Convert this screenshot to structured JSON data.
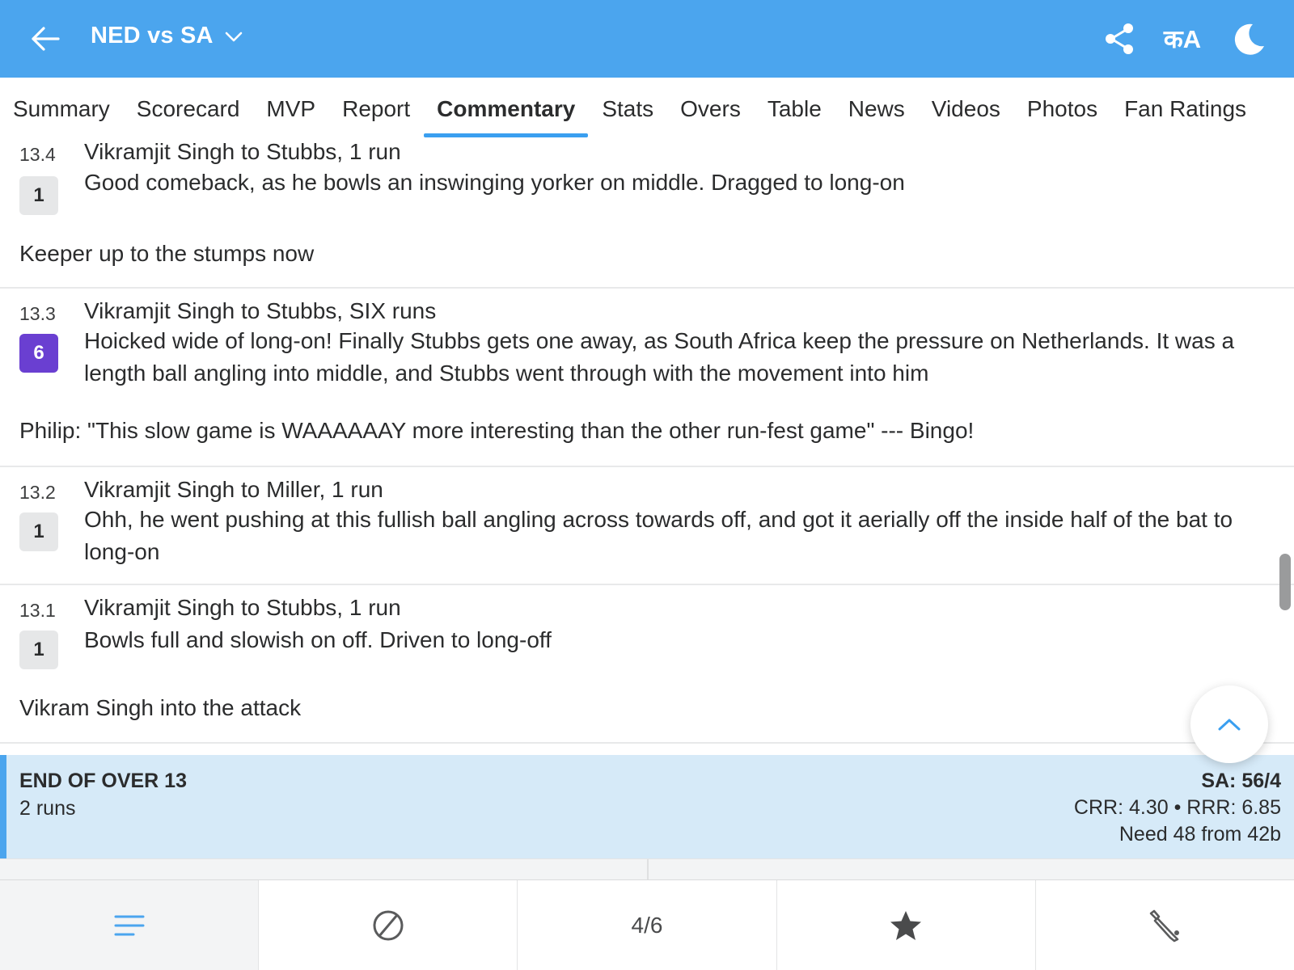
{
  "header": {
    "title": "NED vs SA",
    "language_label": "क​A",
    "icons": [
      "back-arrow-icon",
      "chevron-down-icon",
      "share-icon",
      "language-icon",
      "moon-icon"
    ]
  },
  "tabs": [
    {
      "label": "Summary"
    },
    {
      "label": "Scorecard"
    },
    {
      "label": "MVP"
    },
    {
      "label": "Report"
    },
    {
      "label": "Commentary",
      "active": true
    },
    {
      "label": "Stats"
    },
    {
      "label": "Overs"
    },
    {
      "label": "Table"
    },
    {
      "label": "News"
    },
    {
      "label": "Videos"
    },
    {
      "label": "Photos"
    },
    {
      "label": "Fan Ratings"
    }
  ],
  "commentary": [
    {
      "over": "13.4",
      "runs": "1",
      "title": "Vikramjit Singh to Stubbs, 1 run",
      "text": "Good comeback, as he bowls an inswinging yorker on middle. Dragged to long-on",
      "note": "Keeper up to the stumps now"
    },
    {
      "over": "13.3",
      "runs": "6",
      "title": "Vikramjit Singh to Stubbs, SIX runs",
      "text": "Hoicked wide of long-on! Finally Stubbs gets one away, as South Africa keep the pressure on Netherlands. It was a length ball angling into middle, and Stubbs went through with the movement into him",
      "note": "Philip: \"This slow game is WAAAAAAY more interesting than the other run-fest game\" --- Bingo!"
    },
    {
      "over": "13.2",
      "runs": "1",
      "title": "Vikramjit Singh to Miller, 1 run",
      "text": "Ohh, he went pushing at this fullish ball angling across towards off, and got it aerially off the inside half of the bat to long-on"
    },
    {
      "over": "13.1",
      "runs": "1",
      "title": "Vikramjit Singh to Stubbs, 1 run",
      "text": "Bowls full and slowish on off. Driven to long-off",
      "note": "Vikram Singh into the attack"
    }
  ],
  "end_of_over": {
    "heading": "END OF OVER 13",
    "runs": "2 runs",
    "score": "SA: 56/4",
    "rates": "CRR: 4.30 • RRR: 6.85",
    "need": "Need 48 from 42b"
  },
  "bottom_bar": {
    "page_counter": "4/6",
    "icons": [
      "menu-icon",
      "ball-icon",
      "star-icon",
      "bat-icon"
    ]
  },
  "colors": {
    "header_bg": "#4ba5ee",
    "active_tab_underline": "#3a9ff0",
    "six_badge": "#6a3fd1",
    "end_of_over_bg": "#d6eaf8"
  }
}
